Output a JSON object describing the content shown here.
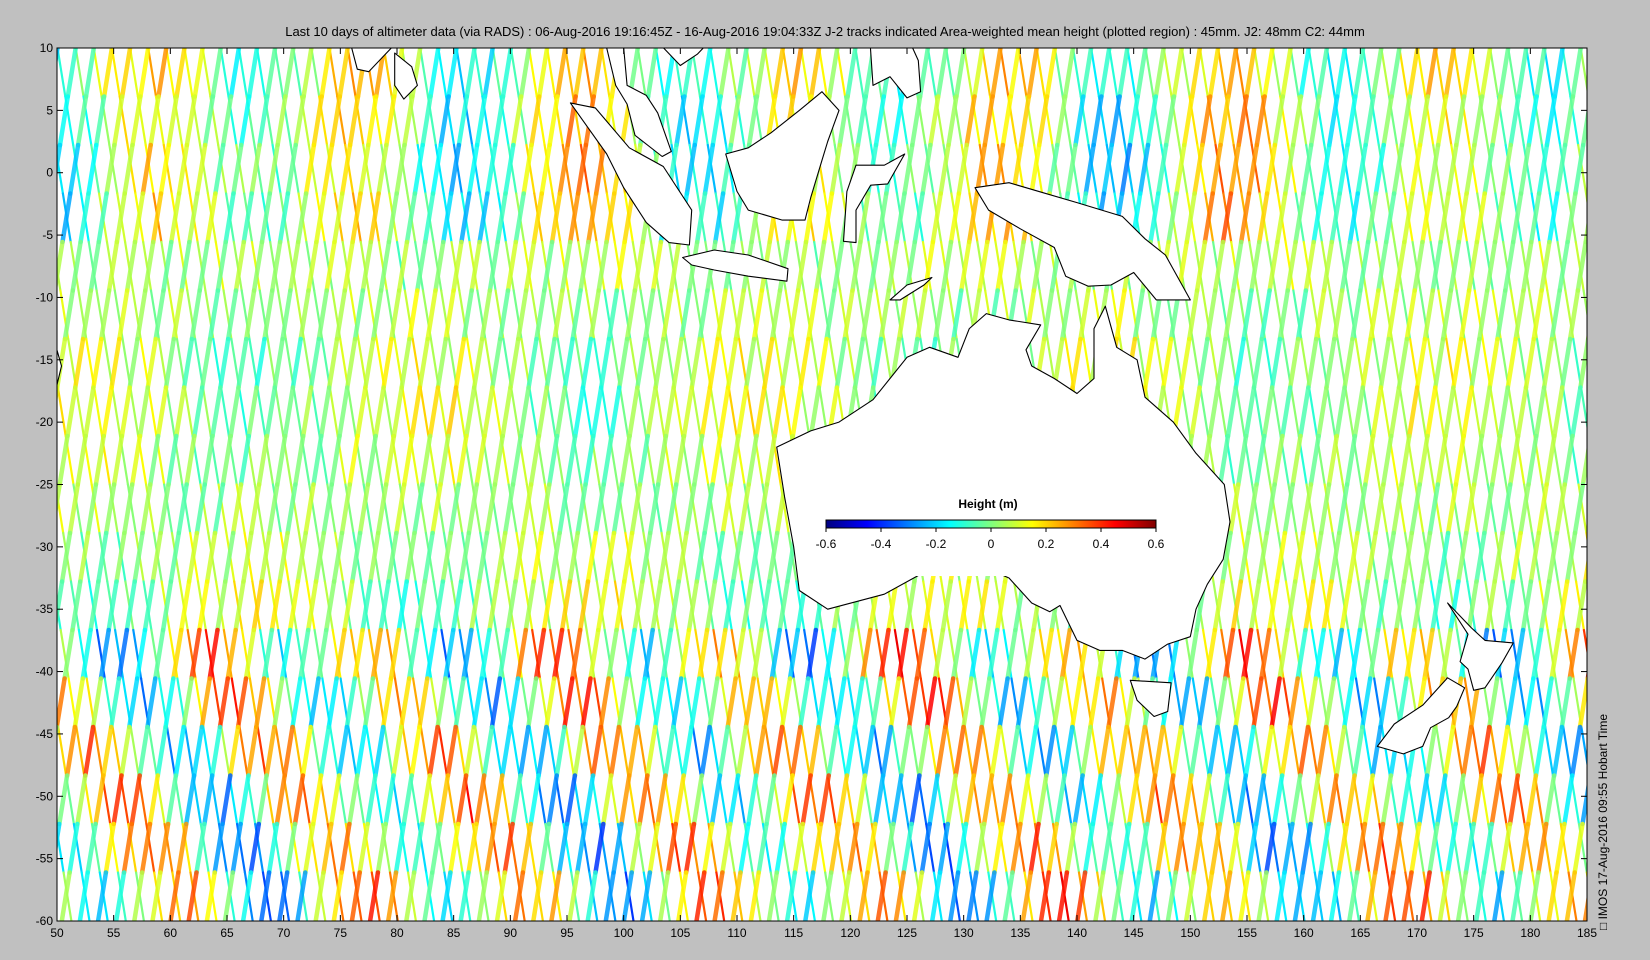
{
  "title": "Last 10 days of altimeter data (via RADS) : 06-Aug-2016 19:16:45Z - 16-Aug-2016 19:04:33Z  J-2 tracks indicated  Area-weighted mean height (plotted region) : 45mm.  J2: 48mm  C2: 44mm",
  "credit": "□ IMOS 17-Aug-2016 09:55 Hobart Time",
  "map": {
    "lon_range": [
      50,
      185
    ],
    "lat_range": [
      -60,
      10
    ],
    "x_ticks": [
      "50",
      "55",
      "60",
      "65",
      "70",
      "75",
      "80",
      "85",
      "90",
      "95",
      "100",
      "105",
      "110",
      "115",
      "120",
      "125",
      "130",
      "135",
      "140",
      "145",
      "150",
      "155",
      "160",
      "165",
      "170",
      "175",
      "180",
      "185"
    ],
    "y_ticks": [
      "10",
      "5",
      "0",
      "-5",
      "-10",
      "-15",
      "-20",
      "-25",
      "-30",
      "-35",
      "-40",
      "-45",
      "-50",
      "-55",
      "-60"
    ],
    "ocean_color": "#ffffff",
    "land_color": "#ffffff"
  },
  "colorbar": {
    "title": "Height (m)",
    "ticks": [
      "-0.6",
      "-0.4",
      "-0.2",
      "0",
      "0.2",
      "0.4",
      "0.6"
    ],
    "range": [
      -0.6,
      0.6
    ],
    "colors": [
      "#00007f",
      "#0000ff",
      "#007fff",
      "#00ffff",
      "#7fff7f",
      "#ffff00",
      "#ff7f00",
      "#ff0000",
      "#7f0000"
    ]
  }
}
